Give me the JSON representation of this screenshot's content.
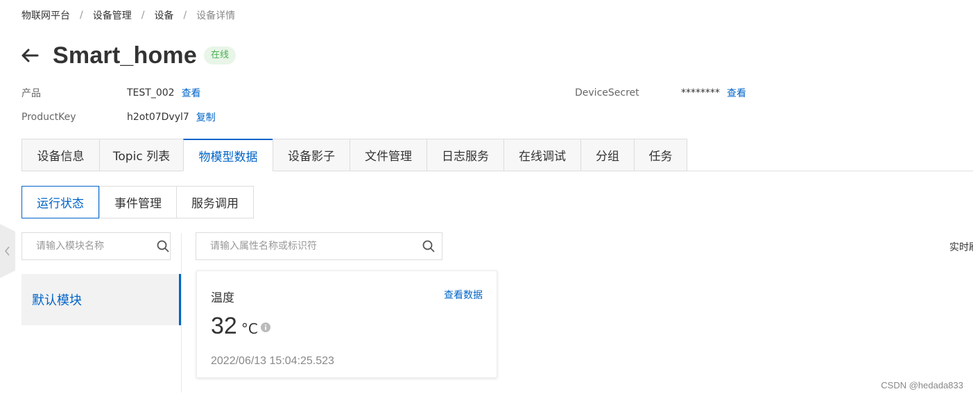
{
  "breadcrumb": [
    "物联网平台",
    "设备管理",
    "设备",
    "设备详情"
  ],
  "device": {
    "name": "Smart_home",
    "status": "在线"
  },
  "meta": {
    "product_label": "产品",
    "product_value": "TEST_002",
    "product_link": "查看",
    "productkey_label": "ProductKey",
    "productkey_value": "h2ot07Dvyl7",
    "productkey_link": "复制",
    "secret_label": "DeviceSecret",
    "secret_value": "********",
    "secret_link": "查看"
  },
  "tabs": [
    "设备信息",
    "Topic 列表",
    "物模型数据",
    "设备影子",
    "文件管理",
    "日志服务",
    "在线调试",
    "分组",
    "任务"
  ],
  "active_tab": 2,
  "subtabs": [
    "运行状态",
    "事件管理",
    "服务调用"
  ],
  "active_subtab": 0,
  "module_search": {
    "placeholder": "请输入模块名称"
  },
  "property_search": {
    "placeholder": "请输入属性名称或标识符"
  },
  "modules": [
    {
      "label": "默认模块"
    }
  ],
  "realtime_label": "实时刷新",
  "property_card": {
    "name": "温度",
    "link": "查看数据",
    "value": "32",
    "unit": "°C",
    "timestamp": "2022/06/13 15:04:25.523"
  },
  "watermark": "CSDN @hedada833",
  "colors": {
    "accent": "#0064c8",
    "online_bg": "#e8f5e8",
    "online_text": "#4caf50"
  }
}
